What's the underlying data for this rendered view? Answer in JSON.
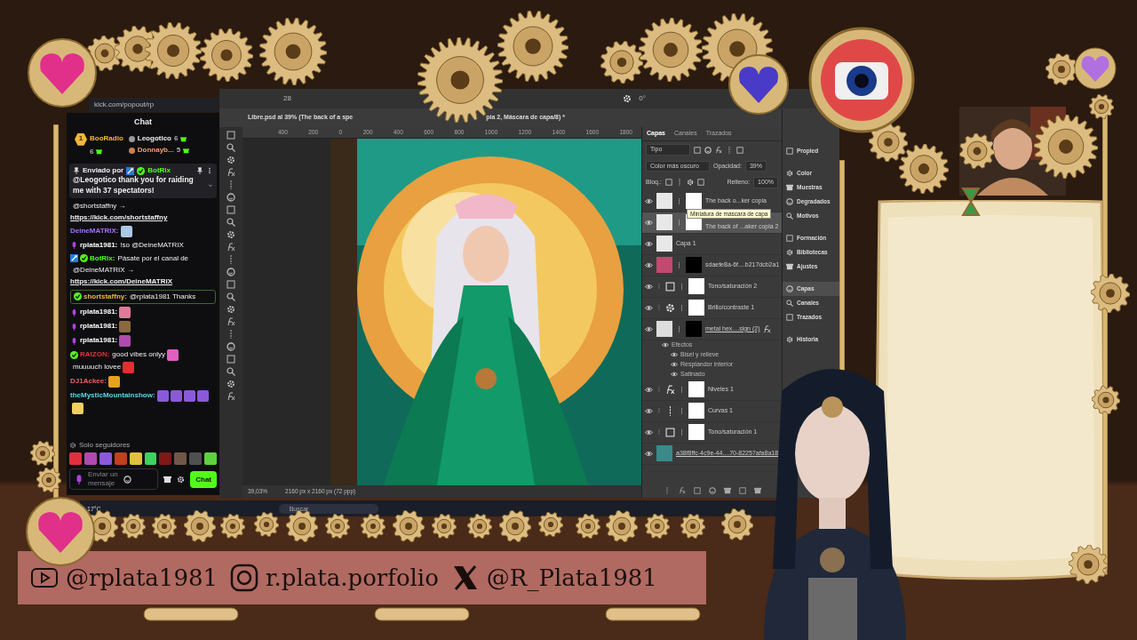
{
  "browser_url": "kick.com/popout/rp",
  "chat": {
    "title": "Chat",
    "leaderboard": {
      "top": {
        "rank": "1",
        "name": "BooRadio",
        "count": "6"
      },
      "others": [
        {
          "name": "Leogotico",
          "count": "6"
        },
        {
          "name": "Donnayb...",
          "count": "5"
        }
      ]
    },
    "pinned": {
      "label": "Enviado por",
      "author": "BotRix",
      "message": "@Leogotico thank you for raiding me with 37 spectators!"
    },
    "messages": [
      {
        "parts": [
          {
            "kind": "text",
            "text": "@shortstaffny →"
          },
          {
            "kind": "link",
            "text": "https://kick.com/shortstaffny"
          }
        ],
        "highlighted": false
      },
      {
        "user": "DeineMATRIX:",
        "color": "#a970ff",
        "parts": [
          {
            "kind": "emote",
            "color": "#a9c9e6"
          }
        ],
        "highlighted": false
      },
      {
        "badges": [
          {
            "kind": "mic"
          }
        ],
        "user": "rplata1981:",
        "color": "#ffffff",
        "parts": [
          {
            "kind": "text",
            "text": "!so @DeineMATRIX"
          }
        ],
        "highlighted": false
      },
      {
        "badges": [
          {
            "kind": "bot"
          },
          {
            "kind": "verified"
          }
        ],
        "user": "BotRix:",
        "color": "#53fc18",
        "parts": [
          {
            "kind": "text",
            "text": "Pásate por el canal de"
          },
          {
            "kind": "text",
            "text": "@DeineMATRIX →"
          },
          {
            "kind": "link",
            "text": "https://kick.com/DeineMATRIX"
          }
        ],
        "highlighted": false
      },
      {
        "badges": [
          {
            "kind": "verified"
          }
        ],
        "user": "shortstaffny:",
        "color": "#f2b63c",
        "parts": [
          {
            "kind": "text",
            "text": "@rplata1981 Thanks"
          }
        ],
        "highlighted": true
      },
      {
        "badges": [
          {
            "kind": "mic"
          }
        ],
        "user": "rplata1981:",
        "color": "#ffffff",
        "parts": [
          {
            "kind": "emote",
            "color": "#e07a9a"
          }
        ],
        "highlighted": false
      },
      {
        "badges": [
          {
            "kind": "mic"
          }
        ],
        "user": "rplata1981:",
        "color": "#ffffff",
        "parts": [
          {
            "kind": "emote",
            "color": "#8a6a3a"
          }
        ],
        "highlighted": false
      },
      {
        "badges": [
          {
            "kind": "mic"
          }
        ],
        "user": "rplata1981:",
        "color": "#ffffff",
        "parts": [
          {
            "kind": "emote",
            "color": "#b04ab0"
          }
        ],
        "highlighted": false
      },
      {
        "badges": [
          {
            "kind": "verified"
          }
        ],
        "user": "RAIZON:",
        "color": "#e8303c",
        "parts": [
          {
            "kind": "text",
            "text": "good vibes onlyy"
          },
          {
            "kind": "emote",
            "color": "#e060c0"
          },
          {
            "kind": "text",
            "text": "muuuuch lovee"
          },
          {
            "kind": "emote",
            "color": "#e03030"
          }
        ],
        "highlighted": false
      },
      {
        "user": "DJ1Ackee:",
        "color": "#f06060",
        "parts": [
          {
            "kind": "emote",
            "color": "#e8a020"
          }
        ],
        "highlighted": false
      },
      {
        "user": "theMysticMountainshow:",
        "color": "#5fd6e6",
        "parts": [
          {
            "kind": "emote",
            "color": "#8a5ad8"
          },
          {
            "kind": "emote",
            "color": "#8a5ad8"
          },
          {
            "kind": "emote",
            "color": "#8a5ad8"
          },
          {
            "kind": "emote",
            "color": "#8a5ad8"
          },
          {
            "kind": "emote",
            "color": "#f0d060"
          }
        ],
        "highlighted": false
      }
    ],
    "mode": "Solo seguidores",
    "emote_bar": [
      {
        "color": "#e03040"
      },
      {
        "color": "#b04ab0"
      },
      {
        "color": "#8a5ad8"
      },
      {
        "color": "#c04020"
      },
      {
        "color": "#e0c040"
      },
      {
        "color": "#40d060"
      },
      {
        "color": "#801818"
      },
      {
        "color": "#705848"
      },
      {
        "color": "#505050"
      },
      {
        "color": "#60d040"
      }
    ],
    "input": {
      "placeholder": "Enviar un mensaje"
    },
    "send_button": "Chat"
  },
  "photoshop": {
    "options": [
      "28",
      "0°"
    ],
    "title_start": "Libre.psd al 39% (The back of a spe",
    "title_end": "pia 2, Máscara de capa/8) *",
    "ruler": [
      "400",
      "200",
      "0",
      "200",
      "400",
      "600",
      "800",
      "1000",
      "1200",
      "1400",
      "1600",
      "1800"
    ],
    "zoom": "39,03%",
    "dimensions": "2160 px x 2160 px (72 ppp)",
    "layers_panel": {
      "tabs": [
        {
          "label": "Capas",
          "selected": true
        },
        {
          "label": "Canales",
          "selected": false
        },
        {
          "label": "Trazados",
          "selected": false
        }
      ],
      "filter": "Tipo",
      "blend_mode": "Color más oscuro",
      "opacity_label": "Opacidad:",
      "opacity": "39%",
      "lock_label": "Bloq.:",
      "fill_label": "Relleno:",
      "fill": "100%",
      "layers": [
        {
          "name": "The back o...ker copia",
          "kind": "pixel",
          "selected": false
        },
        {
          "name": "The back of ...aker copia 2",
          "kind": "pixel",
          "selected": true,
          "tooltip": "Miniatura de máscara de capa"
        },
        {
          "name": "Capa 1",
          "kind": "plain",
          "selected": false
        },
        {
          "name": "sdaefe8a-6f....b217dcb2a1",
          "kind": "art",
          "selected": false
        },
        {
          "name": "Tono/saturación 2",
          "kind": "hue",
          "selected": false
        },
        {
          "name": "Brillo/contraste 1",
          "kind": "brightness",
          "selected": false
        },
        {
          "name": "metal hex....sign (2)",
          "kind": "smart",
          "selected": false,
          "effects_label": "Efectos",
          "effects": [
            "Bisel y relieve",
            "Resplandor interior",
            "Satinado"
          ]
        },
        {
          "name": "Niveles 1",
          "kind": "levels",
          "selected": false
        },
        {
          "name": "Curvas 1",
          "kind": "curves",
          "selected": false
        },
        {
          "name": "Tono/saturación 1",
          "kind": "hue",
          "selected": false
        },
        {
          "name": "a38f8ffc-4c9e-44....70-82257afa8a18",
          "selected": false
        }
      ]
    },
    "side_panel": [
      {
        "label": "Propied",
        "selected": false
      },
      {
        "label": "Color",
        "selected": false
      },
      {
        "label": "Muestras",
        "selected": false
      },
      {
        "label": "Degradados",
        "selected": false
      },
      {
        "label": "Motivos",
        "selected": false
      },
      {
        "label": "Formación",
        "selected": false
      },
      {
        "label": "Bibliotecas",
        "selected": false
      },
      {
        "label": "Ajustes",
        "selected": false
      },
      {
        "label": "Capas",
        "selected": true
      },
      {
        "label": "Canales",
        "selected": false
      },
      {
        "label": "Trazados",
        "selected": false
      },
      {
        "label": "Historia",
        "selected": false
      }
    ]
  },
  "taskbar": {
    "weather": "17°C",
    "search": {
      "placeholder": "Buscar"
    }
  },
  "social": [
    {
      "kind": "youtube",
      "handle": "@rplata1981"
    },
    {
      "kind": "instagram",
      "handle": "r.plata.porfolio"
    },
    {
      "kind": "x",
      "handle": "@R_Plata1981"
    }
  ]
}
